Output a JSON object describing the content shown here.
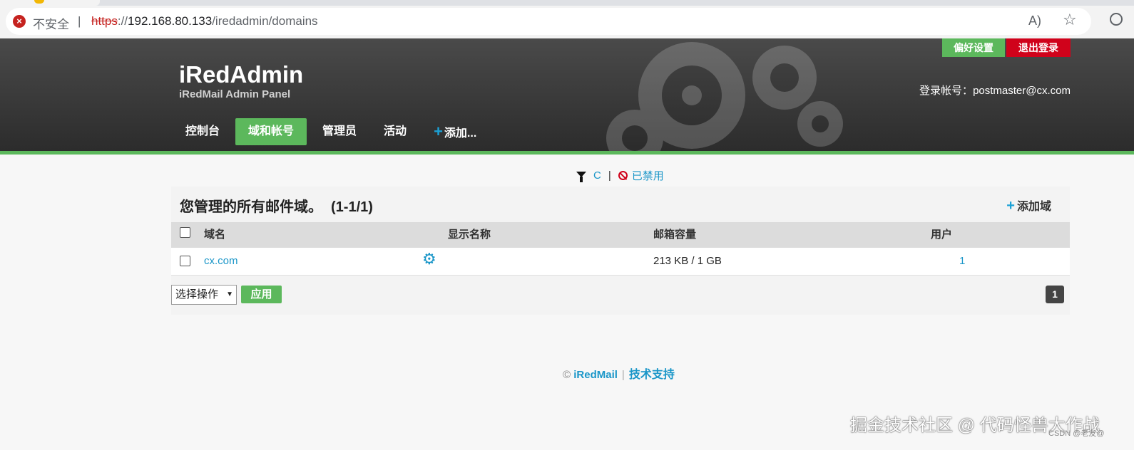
{
  "browser": {
    "security_text": "不安全",
    "separator": "|",
    "url_scheme": "https",
    "url_sep": "://",
    "url_host": "192.168.80.133",
    "url_path": "/iredadmin/domains",
    "read_aloud_glyph": "A)",
    "favorite_glyph": "☆"
  },
  "header": {
    "brand": "iRedAdmin",
    "subtitle": "iRedMail Admin Panel",
    "preferences_label": "偏好设置",
    "logout_label": "退出登录",
    "account_label": "登录帐号：",
    "account_value": "postmaster@cx.com"
  },
  "nav": {
    "items": [
      {
        "label": "控制台",
        "active": false
      },
      {
        "label": "域和帐号",
        "active": true
      },
      {
        "label": "管理员",
        "active": false
      },
      {
        "label": "活动",
        "active": false
      }
    ],
    "add_label": "添加..."
  },
  "filter": {
    "letter": "C",
    "separator": "|",
    "disabled_label": "已禁用"
  },
  "panel": {
    "title": "您管理的所有邮件域。",
    "range": "(1-1/1)",
    "add_domain_label": "添加域",
    "columns": [
      "域名",
      "显示名称",
      "邮箱容量",
      "用户"
    ],
    "rows": [
      {
        "domain": "cx.com",
        "display_name": "",
        "quota": "213 KB / 1 GB",
        "users": "1"
      }
    ],
    "action_select": "选择操作",
    "apply_label": "应用",
    "page": "1"
  },
  "footer": {
    "copyright": "©",
    "brand": "iRedMail",
    "separator": "|",
    "support": "技术支持"
  },
  "watermark": {
    "text": "掘金技术社区 @ 代码怪兽大作战",
    "csdn": "CSDN @老友@"
  },
  "colors": {
    "accent_green": "#5cb85c",
    "logout_red": "#d0021b",
    "link_blue": "#1a96c8"
  }
}
